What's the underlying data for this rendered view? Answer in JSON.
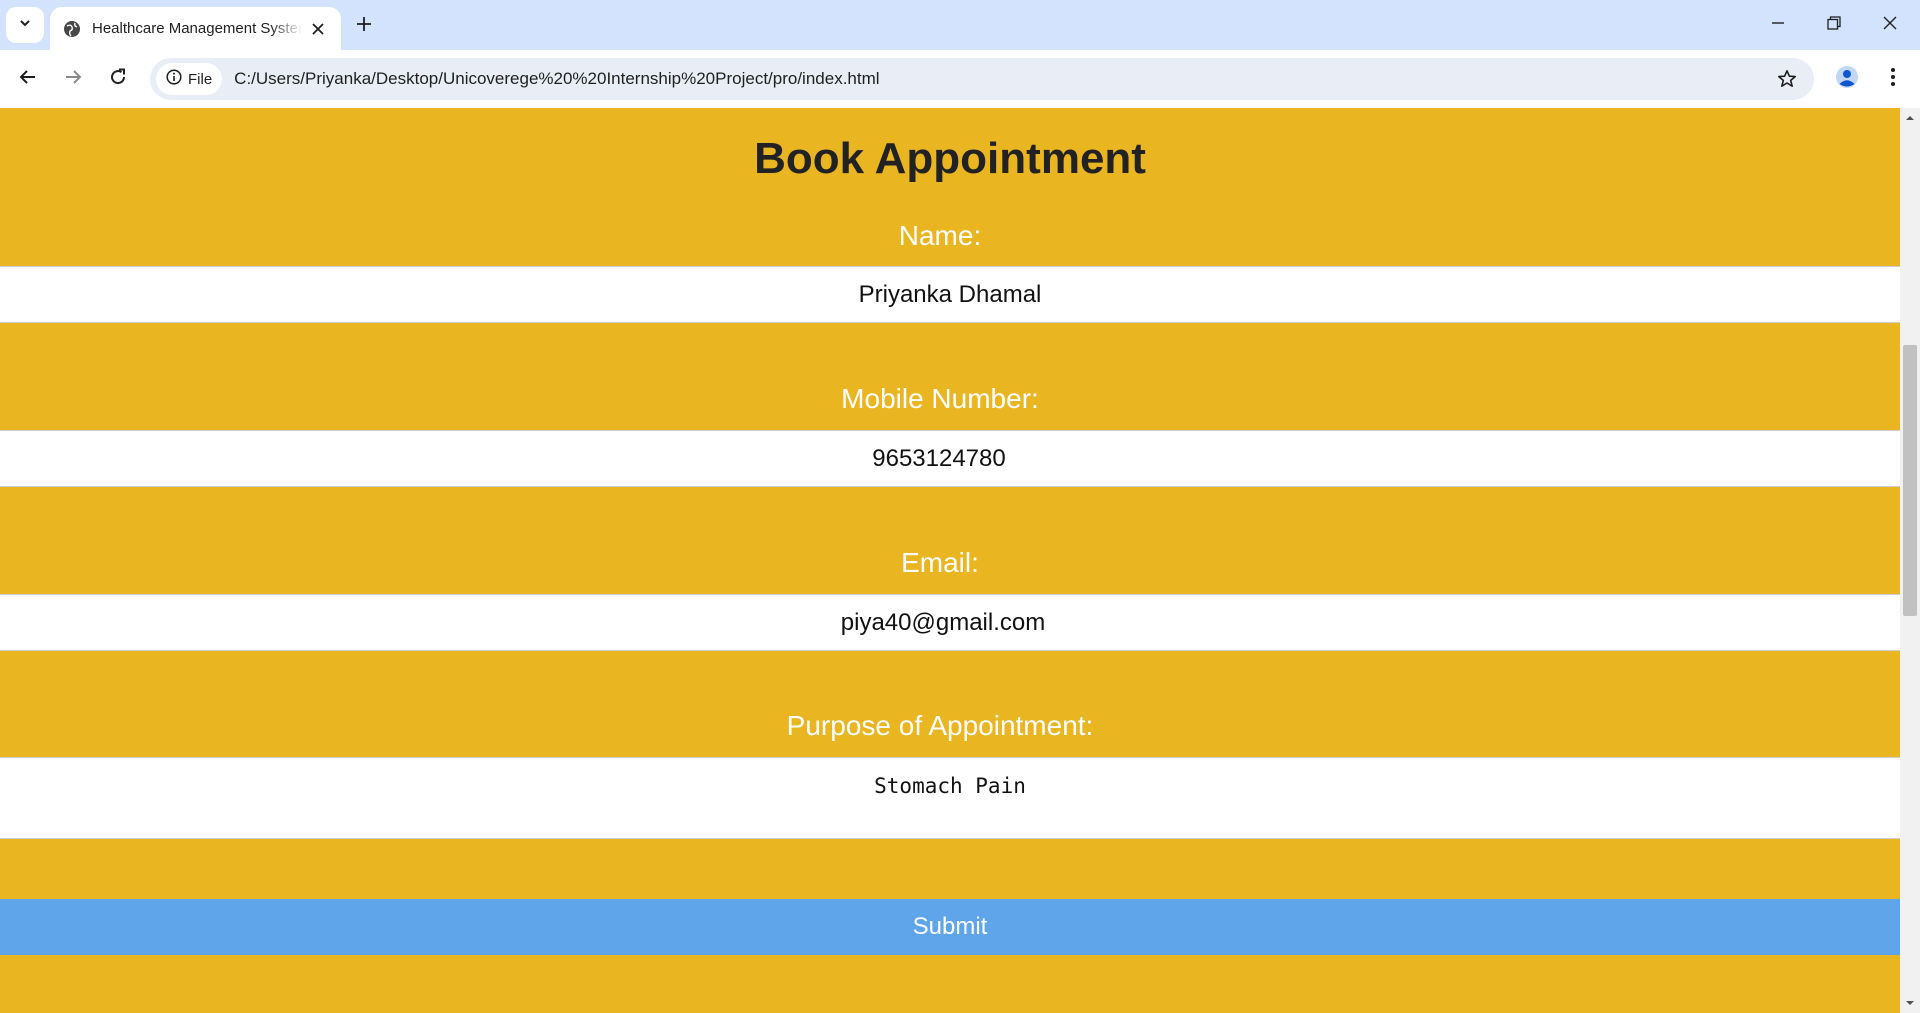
{
  "browser": {
    "tab_title": "Healthcare Management System",
    "url_chip": "File",
    "url": "C:/Users/Priyanka/Desktop/Unicoverege%20%20Internship%20Project/pro/index.html"
  },
  "form": {
    "title": "Book Appointment",
    "name_label": "Name:",
    "name_value": "Priyanka Dhamal",
    "mobile_label": "Mobile Number:",
    "mobile_value": "9653124780",
    "email_label": "Email:",
    "email_value": "piya40@gmail.com",
    "purpose_label": "Purpose of Appointment:",
    "purpose_value": "Stomach Pain",
    "submit_label": "Submit"
  },
  "colors": {
    "page_background": "#e9b520",
    "submit_button": "#5fa5ea",
    "tabstrip": "#d3e3fd"
  },
  "icons": [
    "tab-search-icon",
    "globe-icon",
    "close-icon",
    "plus-icon",
    "minimize-icon",
    "restore-icon",
    "window-close-icon",
    "back-arrow-icon",
    "forward-arrow-icon",
    "reload-icon",
    "info-icon",
    "star-icon",
    "profile-icon",
    "more-vert-icon",
    "scroll-up-icon",
    "scroll-down-icon"
  ]
}
